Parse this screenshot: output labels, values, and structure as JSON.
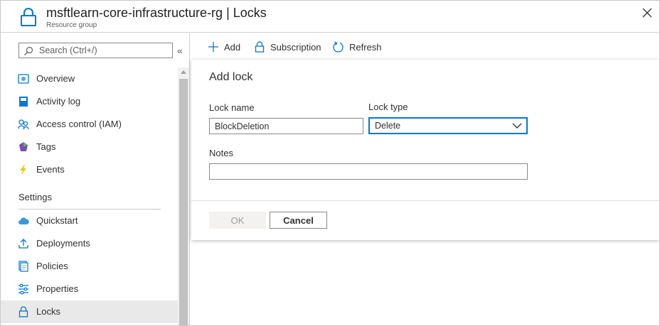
{
  "header": {
    "title": "msftlearn-core-infrastructure-rg | Locks",
    "subtitle": "Resource group",
    "icon": "lock-icon",
    "close_icon": "close-icon"
  },
  "sidebar": {
    "search_placeholder": "Search (Ctrl+/)",
    "collapse_label": "«",
    "items": [
      {
        "label": "Overview",
        "icon": "overview-icon"
      },
      {
        "label": "Activity log",
        "icon": "activity-log-icon"
      },
      {
        "label": "Access control (IAM)",
        "icon": "access-control-icon"
      },
      {
        "label": "Tags",
        "icon": "tag-icon"
      },
      {
        "label": "Events",
        "icon": "lightning-icon"
      }
    ],
    "settings_heading": "Settings",
    "settings_items": [
      {
        "label": "Quickstart",
        "icon": "cloud-icon"
      },
      {
        "label": "Deployments",
        "icon": "upload-icon"
      },
      {
        "label": "Policies",
        "icon": "policies-icon"
      },
      {
        "label": "Properties",
        "icon": "sliders-icon"
      },
      {
        "label": "Locks",
        "icon": "lock-icon",
        "selected": true
      }
    ]
  },
  "toolbar": {
    "add_label": "Add",
    "subscription_label": "Subscription",
    "refresh_label": "Refresh"
  },
  "panel": {
    "title": "Add lock",
    "lock_name_label": "Lock name",
    "lock_name_value": "BlockDeletion",
    "lock_type_label": "Lock type",
    "lock_type_value": "Delete",
    "notes_label": "Notes",
    "notes_value": "",
    "ok_label": "OK",
    "cancel_label": "Cancel"
  },
  "colors": {
    "accent": "#0078d4",
    "selected_bg": "#e9e9e9",
    "disabled_text": "#a19f9d"
  }
}
